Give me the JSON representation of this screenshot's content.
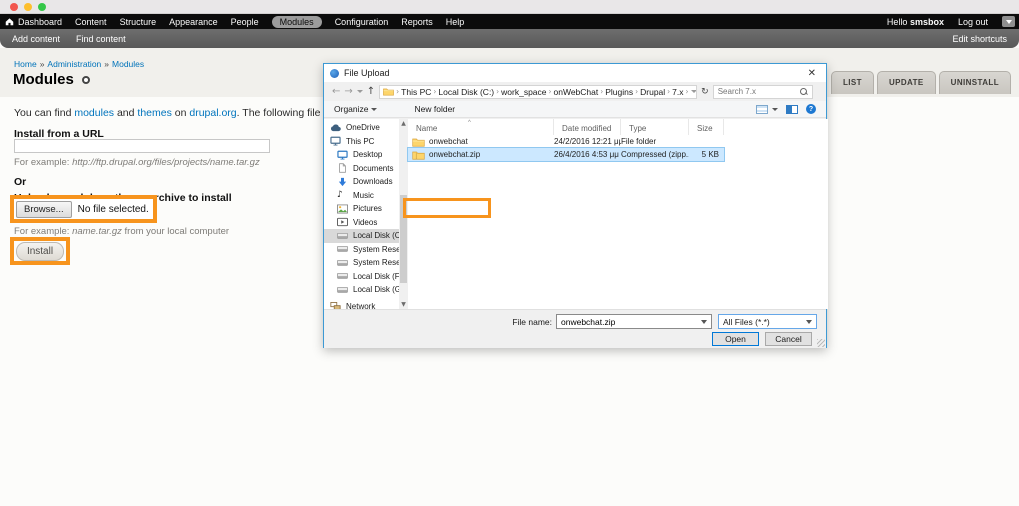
{
  "admin_toolbar": {
    "items": [
      "Dashboard",
      "Content",
      "Structure",
      "Appearance",
      "People",
      "Modules",
      "Configuration",
      "Reports",
      "Help"
    ],
    "active_item": "Modules",
    "greeting_prefix": "Hello",
    "username": "smsbox",
    "logout_label": "Log out"
  },
  "shortcut_bar": {
    "add_content": "Add content",
    "find_content": "Find content",
    "edit_shortcuts": "Edit shortcuts"
  },
  "breadcrumb": {
    "home": "Home",
    "sep": "»",
    "admin": "Administration",
    "current": "Modules"
  },
  "page": {
    "title": "Modules",
    "tabs": [
      {
        "label": "LIST"
      },
      {
        "label": "UPDATE"
      },
      {
        "label": "UNINSTALL"
      }
    ],
    "intro": {
      "part1": "You can find ",
      "link_modules": "modules",
      "part2": " and ",
      "link_themes": "themes",
      "part3": " on ",
      "link_drupal": "drupal.org",
      "part4": ". The following file extensions are suppor"
    },
    "form": {
      "url_label": "Install from a URL",
      "url_value": "",
      "url_example_prefix": "For example: ",
      "url_example": "http://ftp.drupal.org/files/projects/name.tar.gz",
      "or_label": "Or",
      "upload_label": "Upload a module or theme archive to install",
      "browse_label": "Browse...",
      "no_file_label": "No file selected.",
      "upload_example_prefix": "For example: ",
      "upload_example_file": "name.tar.gz",
      "upload_example_suffix": " from your local computer",
      "install_label": "Install"
    }
  },
  "dialog": {
    "title": "File Upload",
    "path": {
      "sep": "›",
      "segments": [
        "This PC",
        "Local Disk (C:)",
        "work_space",
        "onWebChat",
        "Plugins",
        "Drupal",
        "7.x"
      ]
    },
    "search_placeholder": "Search 7.x",
    "toolbar": {
      "organize": "Organize",
      "new_folder": "New folder"
    },
    "sidebar": {
      "items": [
        {
          "label": "OneDrive"
        },
        {
          "label": "This PC"
        },
        {
          "label": "Desktop"
        },
        {
          "label": "Documents"
        },
        {
          "label": "Downloads"
        },
        {
          "label": "Music"
        },
        {
          "label": "Pictures"
        },
        {
          "label": "Videos"
        },
        {
          "label": "Local Disk (C:)",
          "selected": true
        },
        {
          "label": "System Reserved"
        },
        {
          "label": "System Reserved"
        },
        {
          "label": "Local Disk (F:)"
        },
        {
          "label": "Local Disk (G:)"
        },
        {
          "label": "Network"
        }
      ]
    },
    "columns": [
      "Name",
      "Date modified",
      "Type",
      "Size"
    ],
    "files": [
      {
        "name": "onwebchat",
        "date": "24/2/2016 12:21 μμ",
        "type": "File folder",
        "size": ""
      },
      {
        "name": "onwebchat.zip",
        "date": "26/4/2016 4:53 μμ",
        "type": "Compressed (zipp...",
        "size": "5 KB",
        "selected": true
      }
    ],
    "file_name_label": "File name:",
    "file_name_value": "onwebchat.zip",
    "filter_value": "All Files (*.*)",
    "open_label": "Open",
    "cancel_label": "Cancel"
  },
  "glyphs": {
    "close": "✕",
    "help": "?",
    "refresh": "↻",
    "music": "♪",
    "sort": "^",
    "back": "←",
    "forward": "→",
    "up": "↑",
    "scroll_up": "▲",
    "scroll_down": "▼"
  },
  "colors": {
    "annotation_orange": "#F7941D",
    "selection_blue": "#CCE8FF",
    "dialog_border_blue": "#3C99D4",
    "link_blue": "#0074BD",
    "accent_blue": "#0078D7",
    "toolbar_black": "#0C0C0C"
  }
}
